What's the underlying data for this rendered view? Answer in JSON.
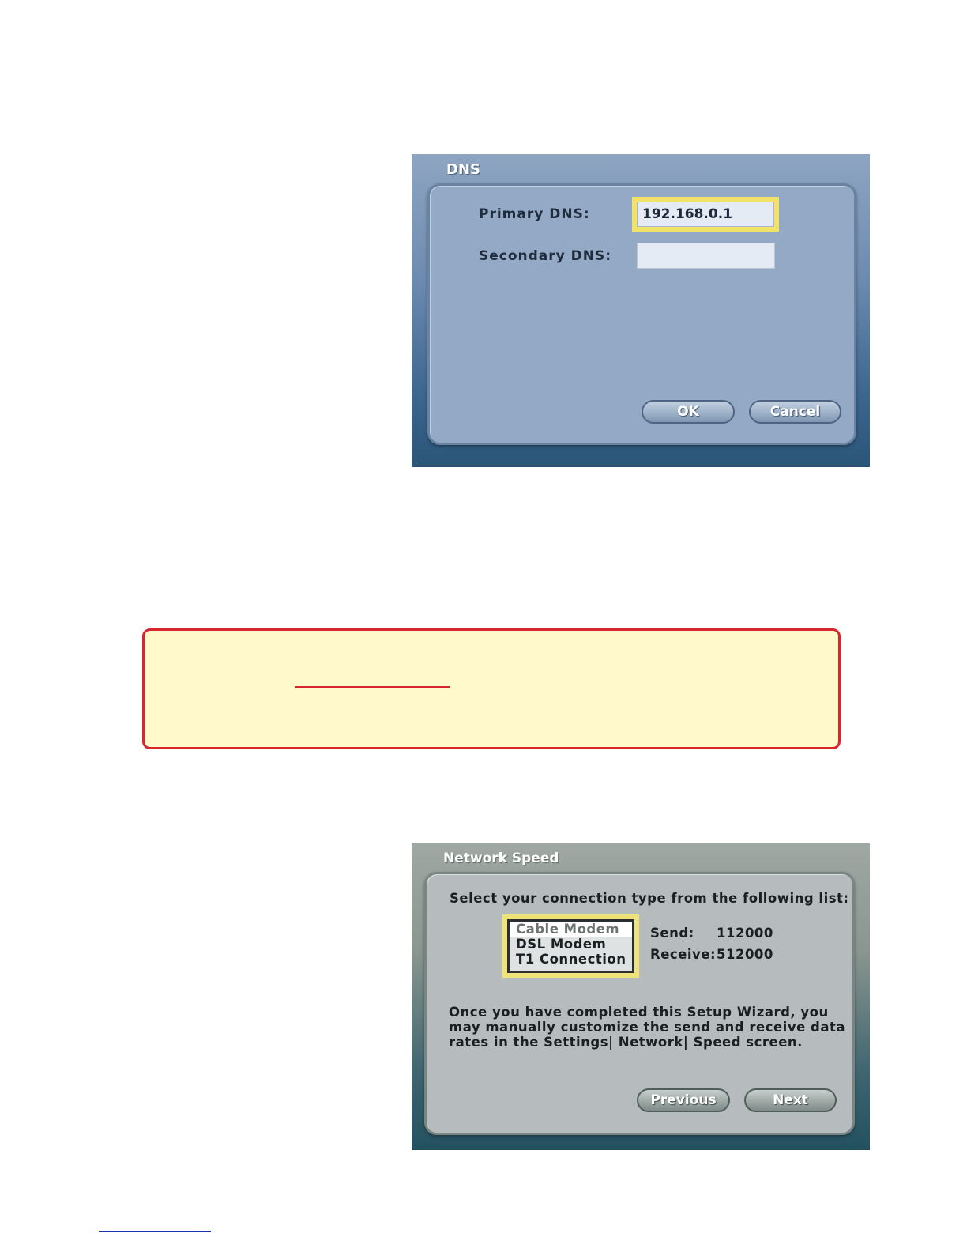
{
  "dns_dialog": {
    "title": "DNS",
    "primary_label": "Primary DNS:",
    "primary_value": "192.168.0.1",
    "secondary_label": "Secondary DNS:",
    "secondary_value": "",
    "ok_label": "OK",
    "cancel_label": "Cancel"
  },
  "network_speed_dialog": {
    "title": "Network Speed",
    "instruction": "Select your connection type from the following list:",
    "options": [
      "Cable Modem",
      "DSL Modem",
      "T1 Connection"
    ],
    "selected_option": "Cable Modem",
    "send_label": "Send:",
    "send_value": "112000",
    "receive_label": "Receive:",
    "receive_value": "512000",
    "info_line1": "Once you have completed this Setup Wizard, you",
    "info_line2": "may manually customize the send and receive data",
    "info_line3": "rates in the Settings| Network| Speed screen.",
    "previous_label": "Previous",
    "next_label": "Next"
  },
  "colors": {
    "note_border": "#d7262e",
    "note_fill": "#fff9cb",
    "focus_highlight": "#f3e26a"
  }
}
